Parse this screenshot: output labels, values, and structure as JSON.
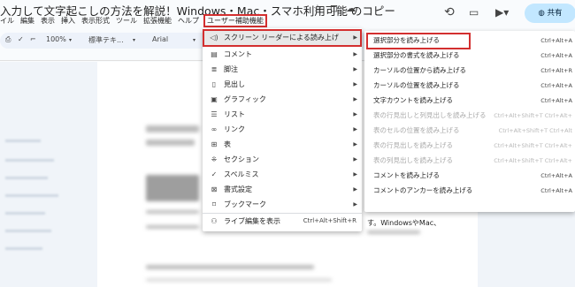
{
  "doc_title": "入力して文字起こしの方法を解説！Windows・Mac・スマホ利用可能 のコピー",
  "menubar": {
    "items": [
      "イル",
      "編集",
      "表示",
      "挿入",
      "表示形式",
      "ツール",
      "拡張機能",
      "ヘルプ"
    ],
    "accessibility": "ユーザー補助機能"
  },
  "share_label": "共有",
  "toolbar": {
    "zoom": "100%",
    "style": "標準テキ...",
    "font": "Arial"
  },
  "main_menu": [
    {
      "label": "スクリーン リーダーによる読み上げ",
      "icon": "speaker-icon",
      "shortcut": "",
      "submenu": true,
      "active": true
    },
    {
      "label": "コメント",
      "icon": "comment-icon",
      "shortcut": "",
      "submenu": true
    },
    {
      "label": "脚注",
      "icon": "footnote-icon",
      "shortcut": "",
      "submenu": true
    },
    {
      "label": "見出し",
      "icon": "heading-icon",
      "shortcut": "",
      "submenu": true
    },
    {
      "label": "グラフィック",
      "icon": "image-icon",
      "shortcut": "",
      "submenu": true
    },
    {
      "label": "リスト",
      "icon": "list-icon",
      "shortcut": "",
      "submenu": true
    },
    {
      "label": "リンク",
      "icon": "link-icon",
      "shortcut": "",
      "submenu": true
    },
    {
      "label": "表",
      "icon": "table-icon",
      "shortcut": "",
      "submenu": true
    },
    {
      "label": "セクション",
      "icon": "section-icon",
      "shortcut": "",
      "submenu": true
    },
    {
      "label": "スペルミス",
      "icon": "spellcheck-icon",
      "shortcut": "",
      "submenu": true
    },
    {
      "label": "書式設定",
      "icon": "formatting-icon",
      "shortcut": "",
      "submenu": true
    },
    {
      "label": "ブックマーク",
      "icon": "bookmark-icon",
      "shortcut": "",
      "submenu": true
    },
    {
      "label": "ライブ編集を表示",
      "icon": "live-edit-icon",
      "shortcut": "Ctrl+Alt+Shift+R",
      "submenu": false
    }
  ],
  "submenu": [
    {
      "label": "選択部分を読み上げる",
      "shortcut": "Ctrl+Alt+A",
      "disabled": false
    },
    {
      "label": "選択部分の書式を読み上げる",
      "shortcut": "Ctrl+Alt+A",
      "disabled": false
    },
    {
      "label": "カーソルの位置から読み上げる",
      "shortcut": "Ctrl+Alt+R",
      "disabled": false
    },
    {
      "label": "カーソルの位置を読み上げる",
      "shortcut": "Ctrl+Alt+A",
      "disabled": false
    },
    {
      "label": "文字カウントを読み上げる",
      "shortcut": "Ctrl+Alt+A",
      "disabled": false
    },
    {
      "label": "表の行見出しと列見出しを読み上げる",
      "shortcut": "Ctrl+Alt+Shift+T Ctrl+Alt+",
      "disabled": true
    },
    {
      "label": "表のセルの位置を読み上げる",
      "shortcut": "Ctrl+Alt+Shift+T Ctrl+Alt",
      "disabled": true
    },
    {
      "label": "表の行見出しを読み上げる",
      "shortcut": "Ctrl+Alt+Shift+T Ctrl+Alt+",
      "disabled": true
    },
    {
      "label": "表の列見出しを読み上げる",
      "shortcut": "Ctrl+Alt+Shift+T Ctrl+Alt+",
      "disabled": true
    },
    {
      "label": "コメントを読み上げる",
      "shortcut": "Ctrl+Alt+A",
      "disabled": false
    },
    {
      "label": "コメントのアンカーを読み上げる",
      "shortcut": "Ctrl+Alt+A",
      "disabled": false
    }
  ],
  "body_snippet": "す。WindowsやMac、"
}
